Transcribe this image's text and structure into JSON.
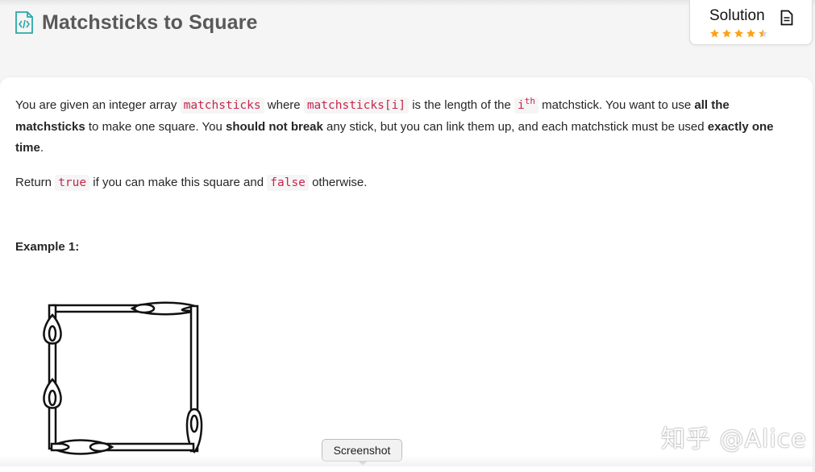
{
  "header": {
    "title": "Matchsticks to Square",
    "icon": "code-file-icon"
  },
  "solution": {
    "label": "Solution",
    "icon": "document-icon",
    "rating": 4.5,
    "star_color": "#ffa116"
  },
  "problem": {
    "p1": {
      "t1": "You are given an integer array ",
      "c1": "matchsticks",
      "t2": " where ",
      "c2": "matchsticks[i]",
      "t3": " is the length of the ",
      "c3": "i",
      "sup": "th",
      "t4": " matchstick. You want to use ",
      "b1": "all the matchsticks",
      "t5": " to make one square. You ",
      "b2": "should not break",
      "t6": " any stick, but you can link them up, and each matchstick must be used ",
      "b3": "exactly one time",
      "t7": "."
    },
    "p2": {
      "t1": "Return ",
      "c1": "true",
      "t2": " if you can make this square and ",
      "c2": "false",
      "t3": " otherwise."
    },
    "example_label": "Example 1:"
  },
  "tooltip": {
    "label": "Screenshot"
  },
  "watermark": {
    "text": "知乎 @Alice"
  }
}
